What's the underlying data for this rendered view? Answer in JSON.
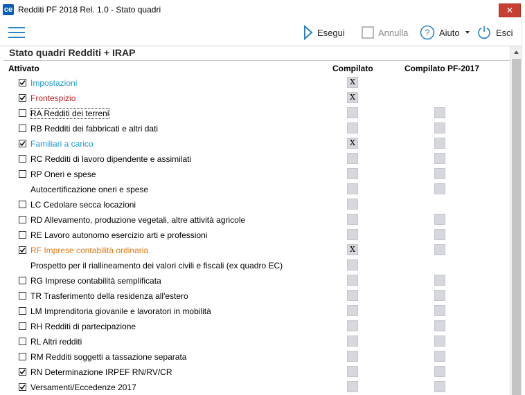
{
  "window": {
    "app_icon": "ce",
    "title": "Redditi PF 2018 Rel. 1.0 - Stato quadri",
    "close_glyph": "✕"
  },
  "toolbar": {
    "menu_icon": "hamburger-menu-icon",
    "run_label": "Esegui",
    "cancel_label": "Annulla",
    "help_label": "Aiuto",
    "exit_label": "Esci",
    "accent_color": "#2a83c7"
  },
  "section": {
    "title": "Stato quadri Redditi + IRAP",
    "col_activated": "Attivato",
    "col_compiled": "Compilato",
    "col_compiled_pf2017": "Compilato PF-2017"
  },
  "rows": [
    {
      "label": "Impostazioni",
      "has_checkbox": true,
      "checked": true,
      "color": "blue",
      "compiled": "X",
      "has_pf2017": false
    },
    {
      "label": "Frontespizio",
      "has_checkbox": true,
      "checked": true,
      "color": "red",
      "compiled": "X",
      "has_pf2017": false
    },
    {
      "label": "RA Redditi dei terreni",
      "has_checkbox": true,
      "checked": false,
      "color": "black",
      "compiled": "",
      "has_pf2017": true,
      "focused": true
    },
    {
      "label": "RB Redditi dei fabbricati e altri dati",
      "has_checkbox": true,
      "checked": false,
      "color": "black",
      "compiled": "",
      "has_pf2017": true
    },
    {
      "label": "Familiari a carico",
      "has_checkbox": true,
      "checked": true,
      "color": "blue",
      "compiled": "X",
      "has_pf2017": true
    },
    {
      "label": "RC Redditi di lavoro dipendente e assimilati",
      "has_checkbox": true,
      "checked": false,
      "color": "black",
      "compiled": "",
      "has_pf2017": true
    },
    {
      "label": "RP Oneri e spese",
      "has_checkbox": true,
      "checked": false,
      "color": "black",
      "compiled": "",
      "has_pf2017": true
    },
    {
      "label": "Autocertificazione oneri e spese",
      "has_checkbox": false,
      "checked": false,
      "color": "black",
      "compiled": "",
      "has_pf2017": true
    },
    {
      "label": "LC Cedolare secca locazioni",
      "has_checkbox": true,
      "checked": false,
      "color": "black",
      "compiled": "",
      "has_pf2017": false
    },
    {
      "label": "RD Allevamento, produzione vegetali, altre attività agricole",
      "has_checkbox": true,
      "checked": false,
      "color": "black",
      "compiled": "",
      "has_pf2017": true
    },
    {
      "label": "RE Lavoro autonomo esercizio arti e professioni",
      "has_checkbox": true,
      "checked": false,
      "color": "black",
      "compiled": "",
      "has_pf2017": true
    },
    {
      "label": "RF Imprese contabilità ordinaria",
      "has_checkbox": true,
      "checked": true,
      "color": "orange",
      "compiled": "X",
      "has_pf2017": true
    },
    {
      "label": "Prospetto per il riallineamento dei valori civili e fiscali (ex quadro EC)",
      "has_checkbox": false,
      "checked": false,
      "color": "black",
      "compiled": "",
      "has_pf2017": false
    },
    {
      "label": "RG Imprese contabilità semplificata",
      "has_checkbox": true,
      "checked": false,
      "color": "black",
      "compiled": "",
      "has_pf2017": true
    },
    {
      "label": "TR Trasferimento della residenza all'estero",
      "has_checkbox": true,
      "checked": false,
      "color": "black",
      "compiled": "",
      "has_pf2017": true
    },
    {
      "label": "LM Imprenditoria giovanile e lavoratori in mobilità",
      "has_checkbox": true,
      "checked": false,
      "color": "black",
      "compiled": "",
      "has_pf2017": true
    },
    {
      "label": "RH Redditi di partecipazione",
      "has_checkbox": true,
      "checked": false,
      "color": "black",
      "compiled": "",
      "has_pf2017": true
    },
    {
      "label": "RL Altri redditi",
      "has_checkbox": true,
      "checked": false,
      "color": "black",
      "compiled": "",
      "has_pf2017": true
    },
    {
      "label": "RM Redditi soggetti a tassazione separata",
      "has_checkbox": true,
      "checked": false,
      "color": "black",
      "compiled": "",
      "has_pf2017": true
    },
    {
      "label": "RN Determinazione IRPEF RN/RV/CR",
      "has_checkbox": true,
      "checked": true,
      "color": "black",
      "compiled": "",
      "has_pf2017": true
    },
    {
      "label": "Versamenti/Eccedenze 2017",
      "has_checkbox": true,
      "checked": true,
      "color": "black",
      "compiled": "",
      "has_pf2017": true
    }
  ]
}
